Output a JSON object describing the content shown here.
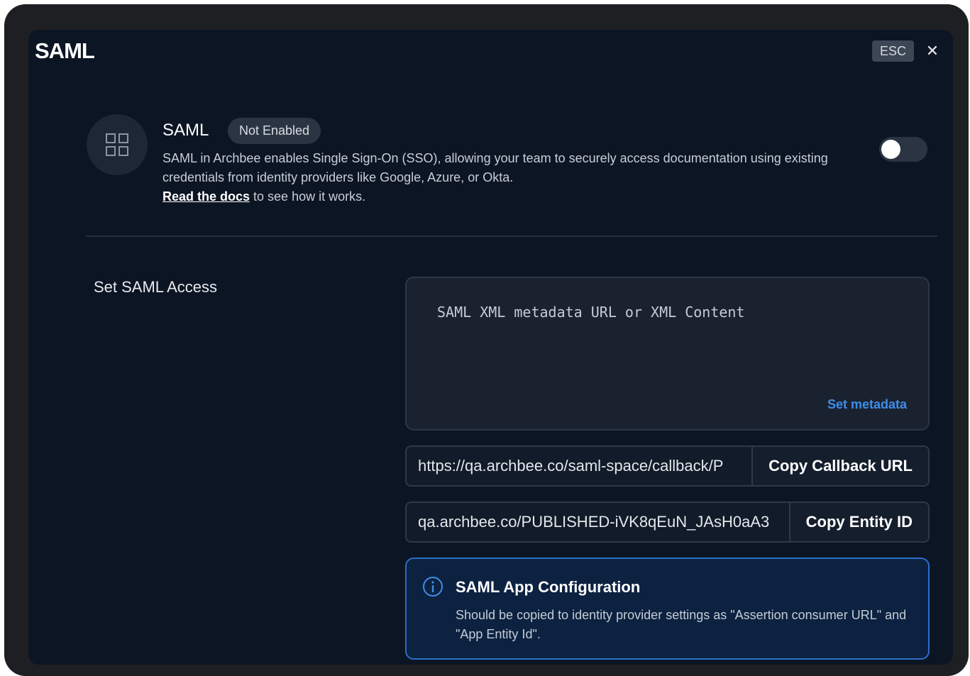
{
  "modal": {
    "title": "SAML",
    "esc_label": "ESC",
    "close_glyph": "✕"
  },
  "feature": {
    "icon": "grid-icon",
    "name": "SAML",
    "status": "Not Enabled",
    "toggle_on": false,
    "description": "SAML in Archbee enables Single Sign-On (SSO), allowing your team to securely access documentation using existing credentials from identity providers like Google, Azure, or Okta.",
    "docs_link": "Read the docs",
    "docs_suffix": " to see how it works."
  },
  "access": {
    "section_label": "Set SAML Access",
    "metadata_placeholder": "SAML XML metadata URL or XML Content",
    "set_metadata_label": "Set metadata",
    "callback_url": "https://qa.archbee.co/saml-space/callback/P",
    "copy_callback_label": "Copy Callback URL",
    "entity_id": "qa.archbee.co/PUBLISHED-iVK8qEuN_JAsH0aA3",
    "copy_entity_label": "Copy Entity ID"
  },
  "info": {
    "icon": "info-icon",
    "title": "SAML App Configuration",
    "text": "Should be copied to identity provider settings as \"Assertion consumer URL\" and \"App Entity Id\"."
  },
  "colors": {
    "modal_bg": "#0c1524",
    "accent_link": "#3e8eea",
    "info_border": "#2a6fc9"
  }
}
